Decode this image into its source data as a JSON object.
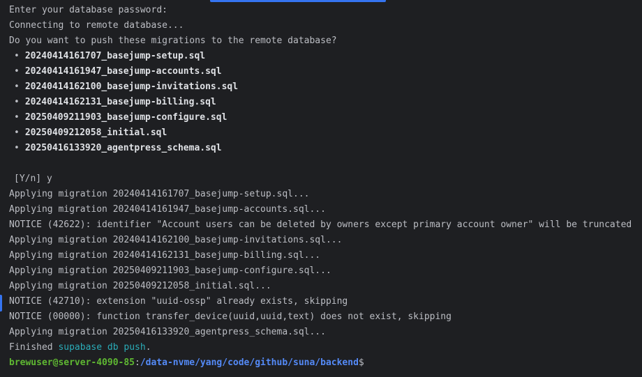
{
  "terminal": {
    "accent": "#3574f0",
    "lines_top": [
      "Enter your database password:",
      "Connecting to remote database...",
      "Do you want to push these migrations to the remote database?"
    ],
    "bullet": "•",
    "migrations": [
      "20240414161707_basejump-setup.sql",
      "20240414161947_basejump-accounts.sql",
      "20240414162100_basejump-invitations.sql",
      "20240414162131_basejump-billing.sql",
      "20250409211903_basejump-configure.sql",
      "20250409212058_initial.sql",
      "20250416133920_agentpress_schema.sql"
    ],
    "confirm_prompt": "[Y/n] y",
    "output": [
      "Applying migration 20240414161707_basejump-setup.sql...",
      "Applying migration 20240414161947_basejump-accounts.sql...",
      "NOTICE (42622): identifier \"Account users can be deleted by owners except primary account owner\" will be truncated",
      "Applying migration 20240414162100_basejump-invitations.sql...",
      "Applying migration 20240414162131_basejump-billing.sql...",
      "Applying migration 20250409211903_basejump-configure.sql...",
      "Applying migration 20250409212058_initial.sql...",
      "NOTICE (42710): extension \"uuid-ossp\" already exists, skipping",
      "NOTICE (00000): function transfer_device(uuid,uuid,text) does not exist, skipping",
      "Applying migration 20250416133920_agentpress_schema.sql..."
    ],
    "finished_prefix": "Finished ",
    "finished_command": "supabase db push",
    "finished_suffix": ".",
    "prompt_user": "brewuser@server-4090-85",
    "prompt_sep": ":",
    "prompt_path": "/data-nvme/yang/code/github/suna/backend",
    "prompt_symbol": "$"
  }
}
